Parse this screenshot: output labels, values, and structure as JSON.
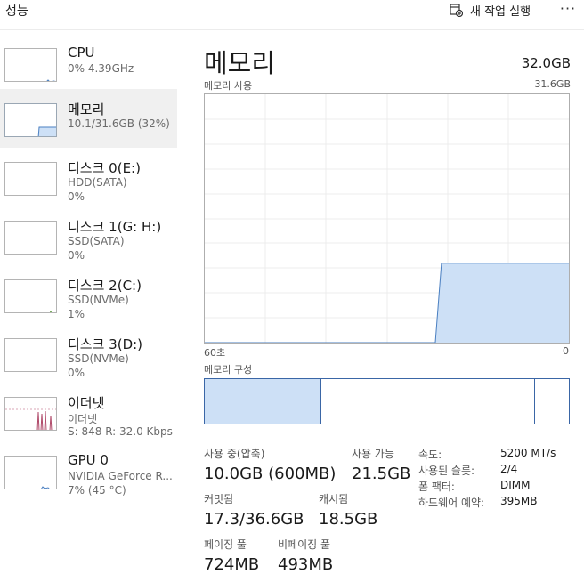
{
  "header": {
    "title": "성능",
    "run_task_label": "새 작업 실행",
    "more_label": "···"
  },
  "colors": {
    "memory_fill": "#cde0f6",
    "memory_line": "#4a7fc1",
    "ethernet_line": "#b04a6a",
    "ethernet_fill": "#f5dce4",
    "cpu_line": "#4a7fc1",
    "gpu_line": "#4a7fc1",
    "selected_bg": "#f0f0f0"
  },
  "sidebar": {
    "items": [
      {
        "name": "CPU",
        "sub1": "0% 4.39GHz",
        "sub2": ""
      },
      {
        "name": "메모리",
        "sub1": "10.1/31.6GB (32%)",
        "sub2": ""
      },
      {
        "name": "디스크 0(E:)",
        "sub1": "HDD(SATA)",
        "sub2": "0%"
      },
      {
        "name": "디스크 1(G: H:)",
        "sub1": "SSD(SATA)",
        "sub2": "0%"
      },
      {
        "name": "디스크 2(C:)",
        "sub1": "SSD(NVMe)",
        "sub2": "1%"
      },
      {
        "name": "디스크 3(D:)",
        "sub1": "SSD(NVMe)",
        "sub2": "0%"
      },
      {
        "name": "이더넷",
        "sub1": "이더넷",
        "sub2": "S: 848 R: 32.0 Kbps"
      },
      {
        "name": "GPU 0",
        "sub1": "NVIDIA GeForce R...",
        "sub2": "7% (45 °C)"
      }
    ]
  },
  "main": {
    "title": "메모리",
    "total": "32.0GB",
    "usage_label": "메모리 사용",
    "usage_max": "31.6GB",
    "axis_left": "60초",
    "axis_right": "0",
    "composition_label": "메모리 구성",
    "composition": {
      "in_use_fraction": 0.32,
      "standby_fraction": 0.58
    },
    "stats": {
      "in_use_label": "사용 중(압축)",
      "in_use_value": "10.0GB (600MB)",
      "available_label": "사용 가능",
      "available_value": "21.5GB",
      "committed_label": "커밋됨",
      "committed_value": "17.3/36.6GB",
      "cached_label": "캐시됨",
      "cached_value": "18.5GB",
      "paged_label": "페이징 풀",
      "paged_value": "724MB",
      "nonpaged_label": "비페이징 풀",
      "nonpaged_value": "493MB"
    },
    "details": {
      "speed_key": "속도:",
      "speed_val": "5200 MT/s",
      "slots_key": "사용된 슬롯:",
      "slots_val": "2/4",
      "form_key": "폼 팩터:",
      "form_val": "DIMM",
      "reserved_key": "하드웨어 예약:",
      "reserved_val": "395MB"
    }
  },
  "chart_data": {
    "type": "area",
    "x_range_seconds": [
      60,
      0
    ],
    "y_range_gb": [
      0,
      31.6
    ],
    "grid": true,
    "history": [
      {
        "t_ago_sec": 60,
        "used_gb": 0
      },
      {
        "t_ago_sec": 22,
        "used_gb": 0
      },
      {
        "t_ago_sec": 21,
        "used_gb": 10.1
      },
      {
        "t_ago_sec": 0,
        "used_gb": 10.1
      }
    ]
  }
}
